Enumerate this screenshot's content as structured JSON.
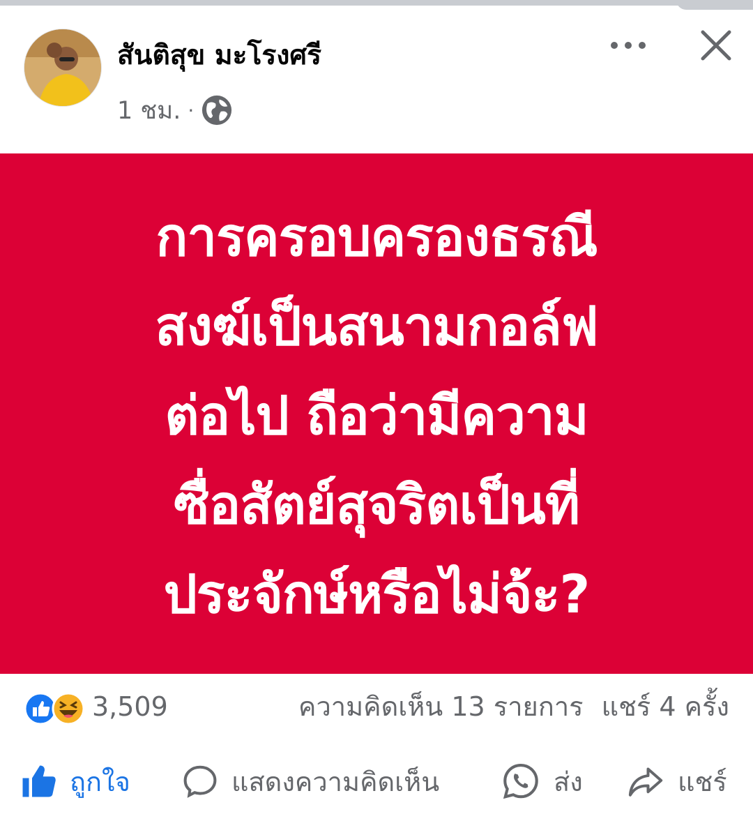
{
  "post": {
    "author": "สันติสุข มะโรงศรี",
    "time": "1 ชม.",
    "separator": "·",
    "privacy_icon": "globe-icon",
    "more_icon": "more-icon",
    "close_icon": "close-icon"
  },
  "banner": {
    "background": "#dc0136",
    "text_color": "#ffffff",
    "lines": [
      "การครอบครองธรณี",
      "สงฆ์เป็นสนามกอล์ฟ",
      "ต่อไป ถือว่ามีความ",
      "ซื่อสัตย์สุจริตเป็นที่",
      "ประจักษ์หรือไม่จ้ะ?"
    ]
  },
  "stats": {
    "reactions": [
      "like-reaction-icon",
      "haha-reaction-icon"
    ],
    "reaction_count": "3,509",
    "comments": "ความคิดเห็น 13 รายการ",
    "shares": "แชร์ 4 ครั้ง"
  },
  "actions": {
    "like": "ถูกใจ",
    "comment": "แสดงความคิดเห็น",
    "send": "ส่ง",
    "share": "แชร์"
  },
  "colors": {
    "accent": "#1b74e4",
    "muted": "#65676b",
    "banner": "#dc0136"
  }
}
